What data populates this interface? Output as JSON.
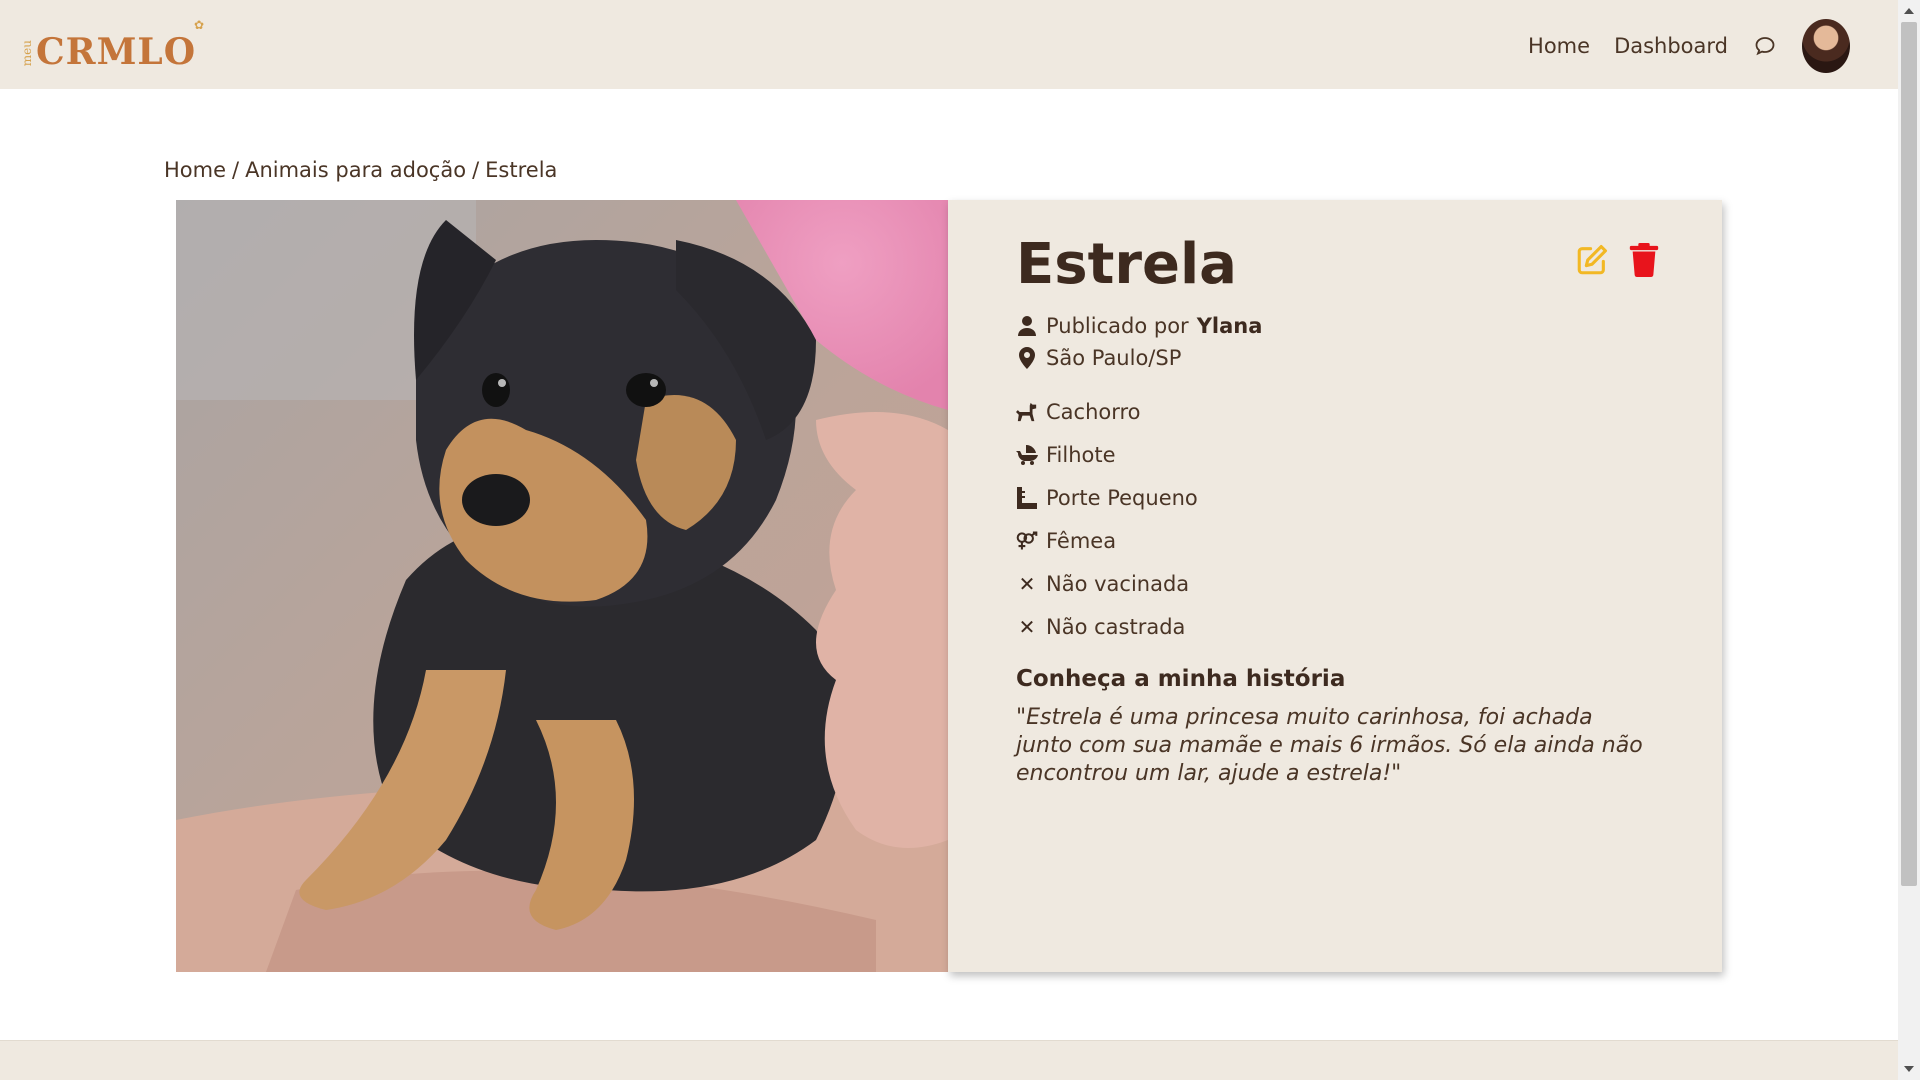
{
  "header": {
    "logo_small": "meu",
    "logo_main": "CRMLO",
    "nav": [
      {
        "label": "Home"
      },
      {
        "label": "Dashboard"
      }
    ],
    "chat_icon": "chat-bubble-icon",
    "avatar": "user-avatar"
  },
  "breadcrumb": {
    "items": [
      "Home",
      "Animais para adoção",
      "Estrela"
    ],
    "separator": "/"
  },
  "pet": {
    "name": "Estrela",
    "published_prefix": "Publicado por",
    "published_by": "Ylana",
    "location": "São Paulo/SP",
    "species": "Cachorro",
    "age": "Filhote",
    "size": "Porte Pequeno",
    "sex": "Fêmea",
    "vaccinated": "Não vacinada",
    "neutered": "Não castrada",
    "story_title": "Conheça a minha história",
    "story_text": "\"Estrela é uma princesa muito carinhosa, foi achada junto com sua mamãe e mais 6 irmãos. Só ela ainda não encontrou um lar, ajude a estrela!\""
  },
  "colors": {
    "header_bg": "#efe9e0",
    "card_bg": "#efe9e0",
    "text": "#3d2a1f",
    "edit": "#f2b824",
    "delete": "#e8141c",
    "logo": "#c4753a"
  },
  "icons": {
    "edit": "edit-icon",
    "delete": "trash-icon",
    "user": "user-icon",
    "location": "map-pin-icon",
    "species": "dog-icon",
    "age": "baby-carriage-icon",
    "size": "ruler-icon",
    "sex": "venus-mars-icon",
    "vaccinated": "x-icon",
    "neutered": "x-icon"
  }
}
